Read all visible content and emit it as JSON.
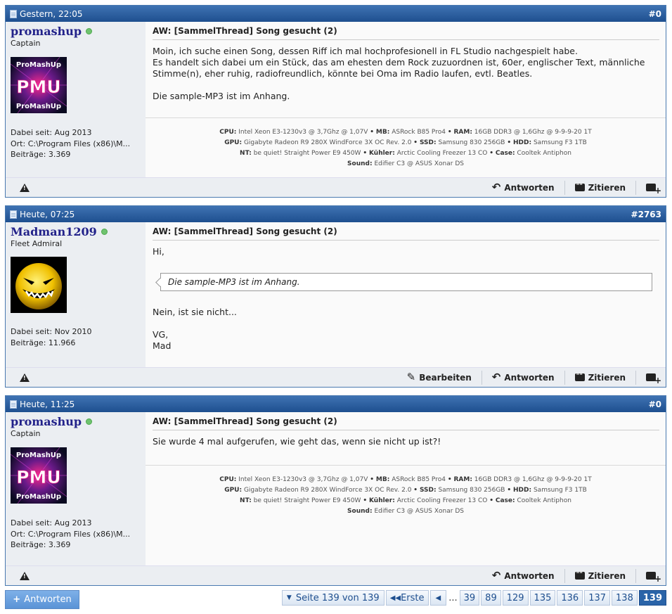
{
  "posts": [
    {
      "date": "Gestern, 22:05",
      "number": "#0",
      "username": "promashup",
      "rank": "Captain",
      "avatar_text_top": "ProMashUp",
      "avatar_text_main": "PMU",
      "avatar_text_bottom": "ProMashUp",
      "joined": "Dabei seit: Aug 2013",
      "location": "Ort: C:\\Program Files (x86)\\M...",
      "posts_count": "Beiträge: 3.369",
      "title": "AW: [SammelThread] Song gesucht (2)",
      "message": [
        "Moin, ich suche einen Song, dessen Riff ich mal hochprofesionell in FL Studio nachgespielt habe.",
        "Es handelt sich dabei um ein Stück, das am ehesten dem Rock zuzuordnen ist, 60er, englischer Text, männliche Stimme(n), eher ruhig, radiofreundlich, könnte bei Oma im Radio laufen, evtl. Beatles.",
        "",
        "Die sample-MP3 ist im Anhang."
      ],
      "actions": [
        "Antworten",
        "Zitieren"
      ]
    },
    {
      "date": "Heute, 07:25",
      "number": "#2763",
      "username": "Madman1209",
      "rank": "Fleet Admiral",
      "joined": "Dabei seit: Nov 2010",
      "posts_count": "Beiträge: 11.966",
      "title": "AW: [SammelThread] Song gesucht (2)",
      "greeting": "Hi,",
      "quote": "Die sample-MP3 ist im Anhang.",
      "reply_line": "Nein, ist sie nicht...",
      "signoff1": "VG,",
      "signoff2": "Mad",
      "actions": [
        "Bearbeiten",
        "Antworten",
        "Zitieren"
      ]
    },
    {
      "date": "Heute, 11:25",
      "number": "#0",
      "username": "promashup",
      "rank": "Captain",
      "joined": "Dabei seit: Aug 2013",
      "location": "Ort: C:\\Program Files (x86)\\M...",
      "posts_count": "Beiträge: 3.369",
      "title": "AW: [SammelThread] Song gesucht (2)",
      "message": "Sie wurde 4 mal aufgerufen, wie geht das, wenn sie nicht up ist?!",
      "actions": [
        "Antworten",
        "Zitieren"
      ]
    }
  ],
  "signature": {
    "cpu_label": "CPU:",
    "cpu": "Intel Xeon E3-1230v3 @ 3,7Ghz @ 1,07V",
    "mb_label": "MB:",
    "mb": "ASRock B85 Pro4",
    "ram_label": "RAM:",
    "ram": "16GB DDR3 @ 1,6Ghz @ 9-9-9-20 1T",
    "gpu_label": "GPU:",
    "gpu": "Gigabyte Radeon R9 280X WindForce 3X OC Rev. 2.0",
    "ssd_label": "SSD:",
    "ssd": "Samsung 830 256GB",
    "hdd_label": "HDD:",
    "hdd": "Samsung F3 1TB",
    "nt_label": "NT:",
    "nt": "be quiet! Straight Power E9 450W",
    "cooler_label": "Kühler:",
    "cooler": "Arctic Cooling Freezer 13 CO",
    "case_label": "Case:",
    "case": "Cooltek Antiphon",
    "sound_label": "Sound:",
    "sound": "Edifier C3 @ ASUS Xonar DS",
    "bullet": "•"
  },
  "footer": {
    "reply_button": "Antworten",
    "page_of": "Seite 139 von 139",
    "first": "Erste",
    "ellipsis": "...",
    "pages": [
      "39",
      "89",
      "129",
      "135",
      "136",
      "137",
      "138"
    ],
    "current_page": "139"
  },
  "colors": {
    "header_blue": "#1e4f8f",
    "username": "#22228a",
    "online": "#6fc36f",
    "current_page": "#2a64a8"
  }
}
